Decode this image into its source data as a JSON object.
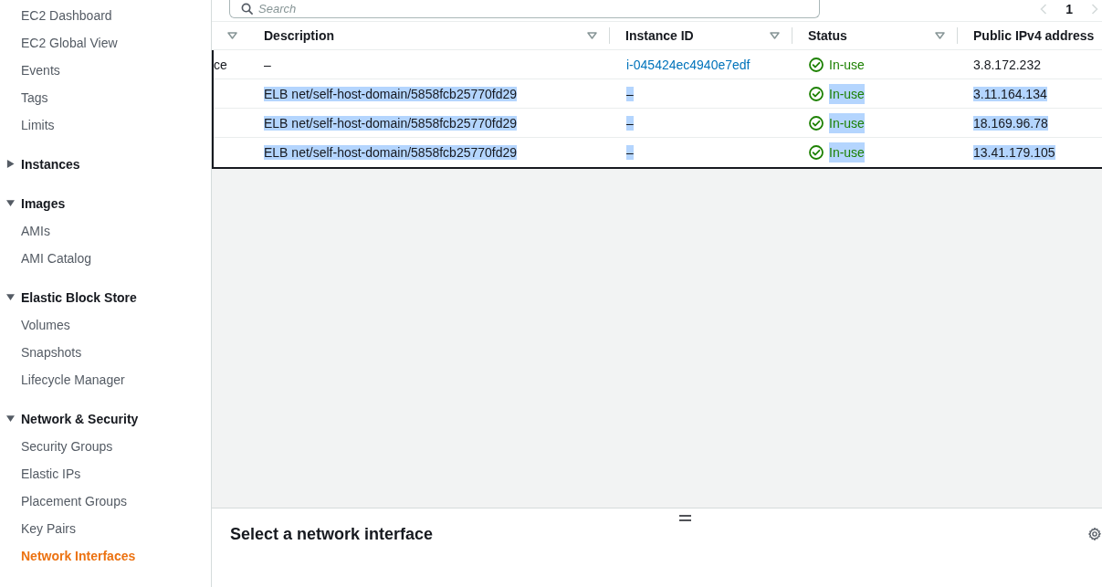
{
  "sidebar": {
    "sections": [
      {
        "items": [
          {
            "label": "EC2 Dashboard",
            "selected": false
          },
          {
            "label": "EC2 Global View",
            "selected": false
          },
          {
            "label": "Events",
            "selected": false
          },
          {
            "label": "Tags",
            "selected": false
          },
          {
            "label": "Limits",
            "selected": false
          }
        ]
      },
      {
        "title": "Instances",
        "expanded": false
      },
      {
        "title": "Images",
        "expanded": true,
        "items": [
          {
            "label": "AMIs",
            "selected": false
          },
          {
            "label": "AMI Catalog",
            "selected": false
          }
        ]
      },
      {
        "title": "Elastic Block Store",
        "expanded": true,
        "items": [
          {
            "label": "Volumes",
            "selected": false
          },
          {
            "label": "Snapshots",
            "selected": false
          },
          {
            "label": "Lifecycle Manager",
            "selected": false
          }
        ]
      },
      {
        "title": "Network & Security",
        "expanded": true,
        "items": [
          {
            "label": "Security Groups",
            "selected": false
          },
          {
            "label": "Elastic IPs",
            "selected": false
          },
          {
            "label": "Placement Groups",
            "selected": false
          },
          {
            "label": "Key Pairs",
            "selected": false
          },
          {
            "label": "Network Interfaces",
            "selected": true
          }
        ]
      }
    ]
  },
  "search": {
    "placeholder": "Search"
  },
  "pagination": {
    "previous_disabled": true,
    "next_disabled": true,
    "pages": [
      {
        "label": "1",
        "selected": true
      }
    ]
  },
  "table": {
    "columns": [
      {
        "sortable": true
      },
      {
        "label": "Description",
        "sortable": true
      },
      {
        "label": "Instance ID",
        "sortable": true
      },
      {
        "label": "Status",
        "sortable": true
      },
      {
        "label": "Public IPv4 address",
        "sortable": false
      }
    ],
    "rows": [
      {
        "column_1": "ce",
        "description": "–",
        "instance_id": "i-045424ec4940e7edf",
        "instance_id_link": true,
        "status": "In-use",
        "public_ipv4": "3.8.172.232",
        "text_selected": false
      },
      {
        "description": "ELB net/self-host-domain/5858fcb25770fd29",
        "instance_id": "–",
        "instance_id_link": false,
        "status": "In-use",
        "public_ipv4": "3.11.164.134",
        "text_selected": true
      },
      {
        "description": "ELB net/self-host-domain/5858fcb25770fd29",
        "instance_id": "–",
        "instance_id_link": false,
        "status": "In-use",
        "public_ipv4": "18.169.96.78",
        "text_selected": true
      },
      {
        "description": "ELB net/self-host-domain/5858fcb25770fd29",
        "instance_id": "–",
        "instance_id_link": false,
        "status": "In-use",
        "public_ipv4": "13.41.179.105",
        "text_selected": true
      }
    ]
  },
  "details_panel": {
    "title": "Select a network interface"
  }
}
